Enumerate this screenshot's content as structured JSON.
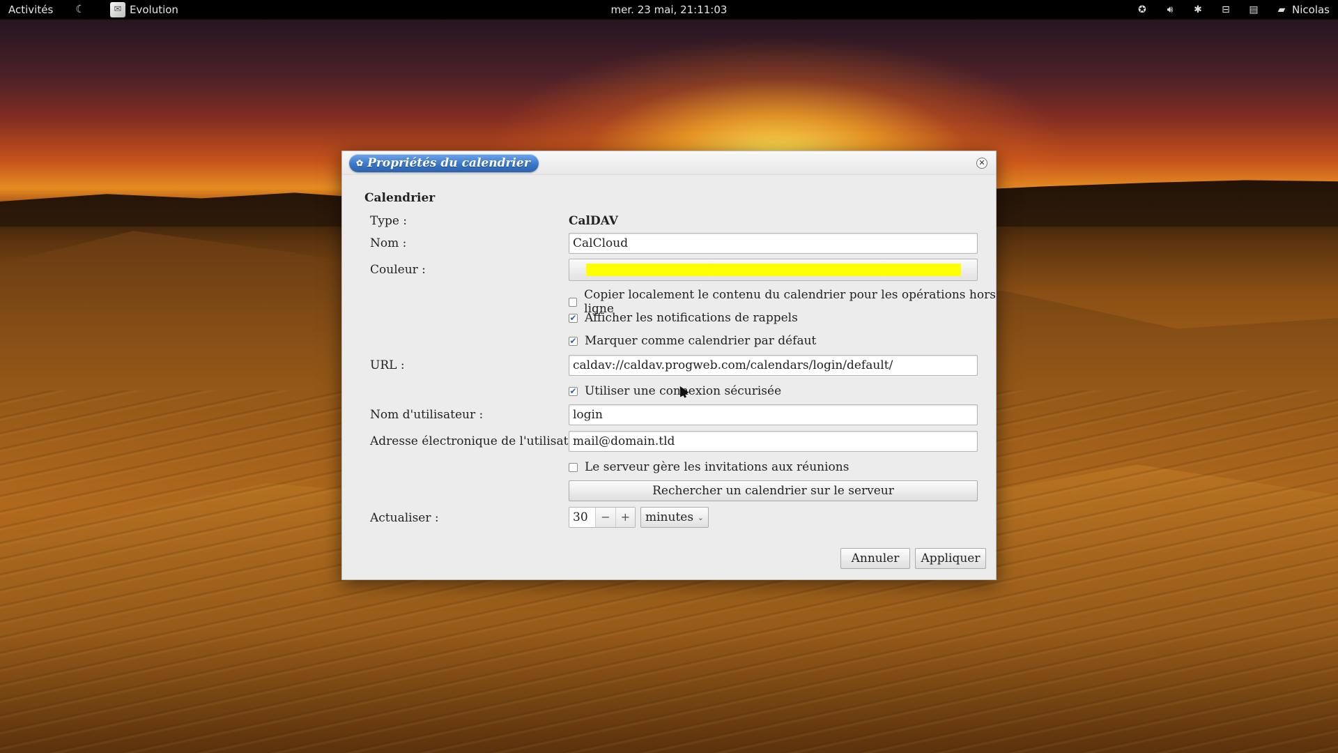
{
  "topbar": {
    "activities": "Activités",
    "app_name": "Evolution",
    "clock": "mer. 23 mai, 21:11:03",
    "user": "Nicolas",
    "icons": [
      "accessibility-icon",
      "volume-icon",
      "bluetooth-icon",
      "network-icon",
      "clipboard-icon",
      "chat-icon"
    ]
  },
  "dialog": {
    "title": "Propriétés du calendrier",
    "section": "Calendrier",
    "type_label": "Type :",
    "type_value": "CalDAV",
    "name_label": "Nom :",
    "name_value": "CalCloud",
    "color_label": "Couleur :",
    "color_value": "#ffff00",
    "copy_offline": {
      "label": "Copier localement le contenu du calendrier pour les opérations hors ligne",
      "checked": false
    },
    "show_reminders": {
      "label": "Afficher les notifications de rappels",
      "checked": true
    },
    "mark_default": {
      "label": "Marquer comme calendrier par défaut",
      "checked": true
    },
    "url_label": "URL :",
    "url_value": "caldav://caldav.progweb.com/calendars/login/default/",
    "secure_conn": {
      "label": "Utiliser une connexion sécurisée",
      "checked": true
    },
    "username_label": "Nom d'utilisateur :",
    "username_value": "login",
    "email_label": "Adresse électronique de l'utilisateur :",
    "email_value": "mail@domain.tld",
    "server_invites": {
      "label": "Le serveur gère les invitations aux réunions",
      "checked": false
    },
    "find_calendar_button": "Rechercher un calendrier sur le serveur",
    "refresh_label": "Actualiser :",
    "refresh_value": "30",
    "spin_minus": "−",
    "spin_plus": "+",
    "refresh_unit": "minutes",
    "cancel_button": "Annuler",
    "apply_button": "Appliquer"
  }
}
